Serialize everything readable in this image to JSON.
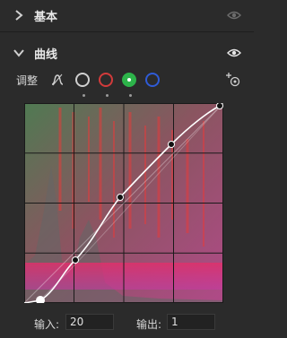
{
  "panels": {
    "basic": {
      "title": "基本"
    },
    "curves": {
      "title": "曲线"
    }
  },
  "adjust": {
    "label": "调整"
  },
  "channels": [
    "rgb",
    "red",
    "green",
    "blue"
  ],
  "selected_channel": "green",
  "colors": {
    "accent_green": "#2db34a",
    "red": "#d23b3b",
    "blue": "#2f5bd6",
    "bg": "#2b2b2b"
  },
  "curve_points": [
    {
      "input": 0,
      "output": 0
    },
    {
      "input": 65,
      "output": 48
    },
    {
      "input": 120,
      "output": 118
    },
    {
      "input": 185,
      "output": 172
    },
    {
      "input": 255,
      "output": 255
    }
  ],
  "io": {
    "input_label": "输入:",
    "input_value": "20",
    "output_label": "输出:",
    "output_value": "1"
  }
}
